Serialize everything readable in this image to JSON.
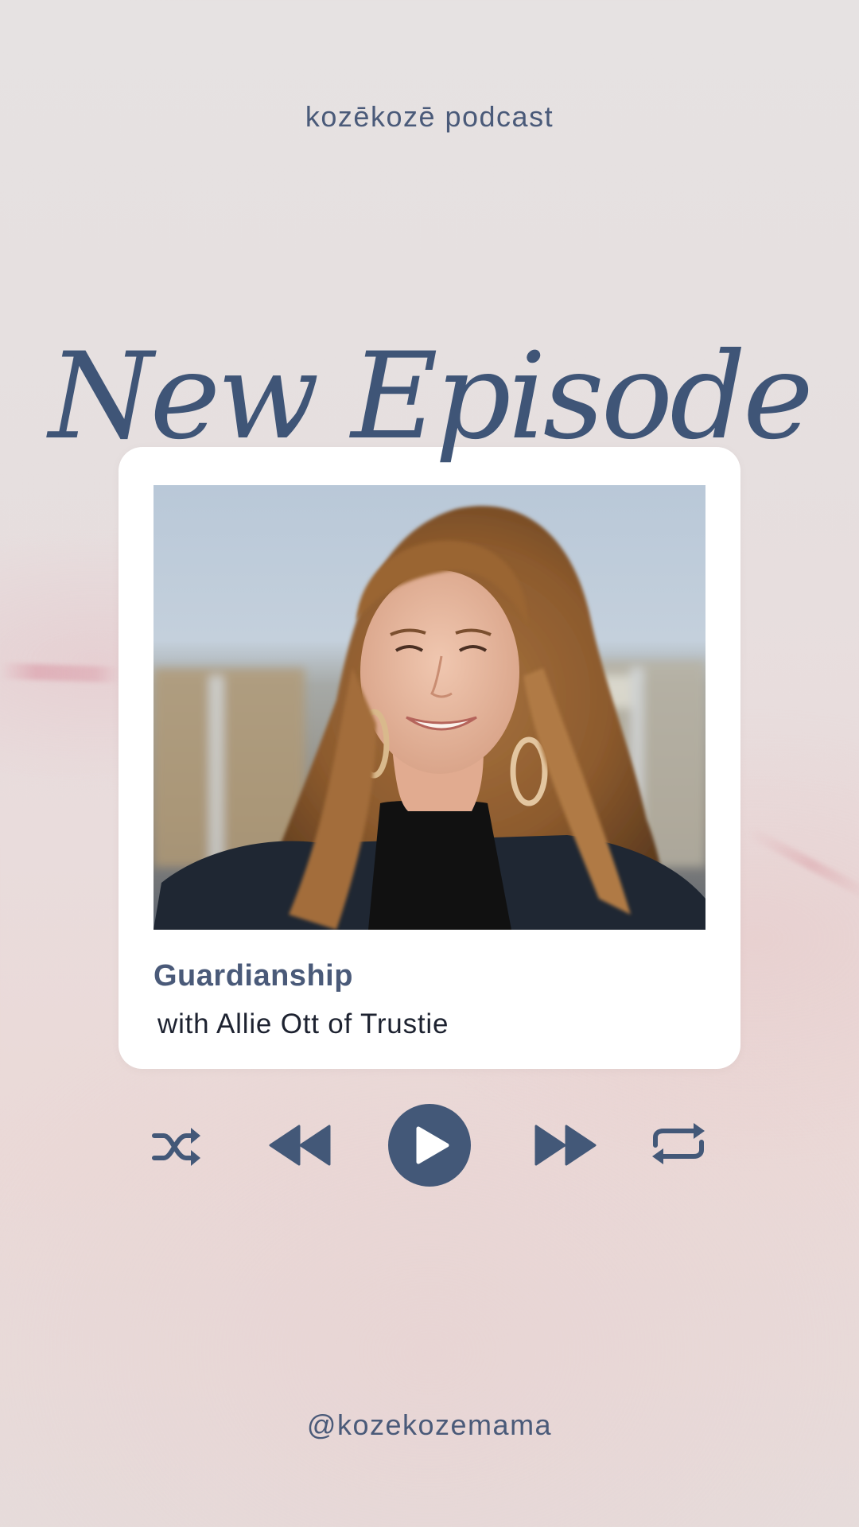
{
  "header": {
    "brand": "kozēkozē podcast"
  },
  "headline": {
    "text": "New Episode"
  },
  "episode": {
    "title": "Guardianship",
    "subtitle": "with Allie Ott of Trustie"
  },
  "controls": {
    "shuffle_icon": "shuffle-icon",
    "previous_icon": "rewind-icon",
    "play_icon": "play-icon",
    "next_icon": "fast-forward-icon",
    "repeat_icon": "repeat-icon"
  },
  "footer": {
    "handle": "@kozekozemama"
  },
  "colors": {
    "accent": "#435878",
    "text_dark": "#1d2230",
    "card": "#ffffff"
  }
}
